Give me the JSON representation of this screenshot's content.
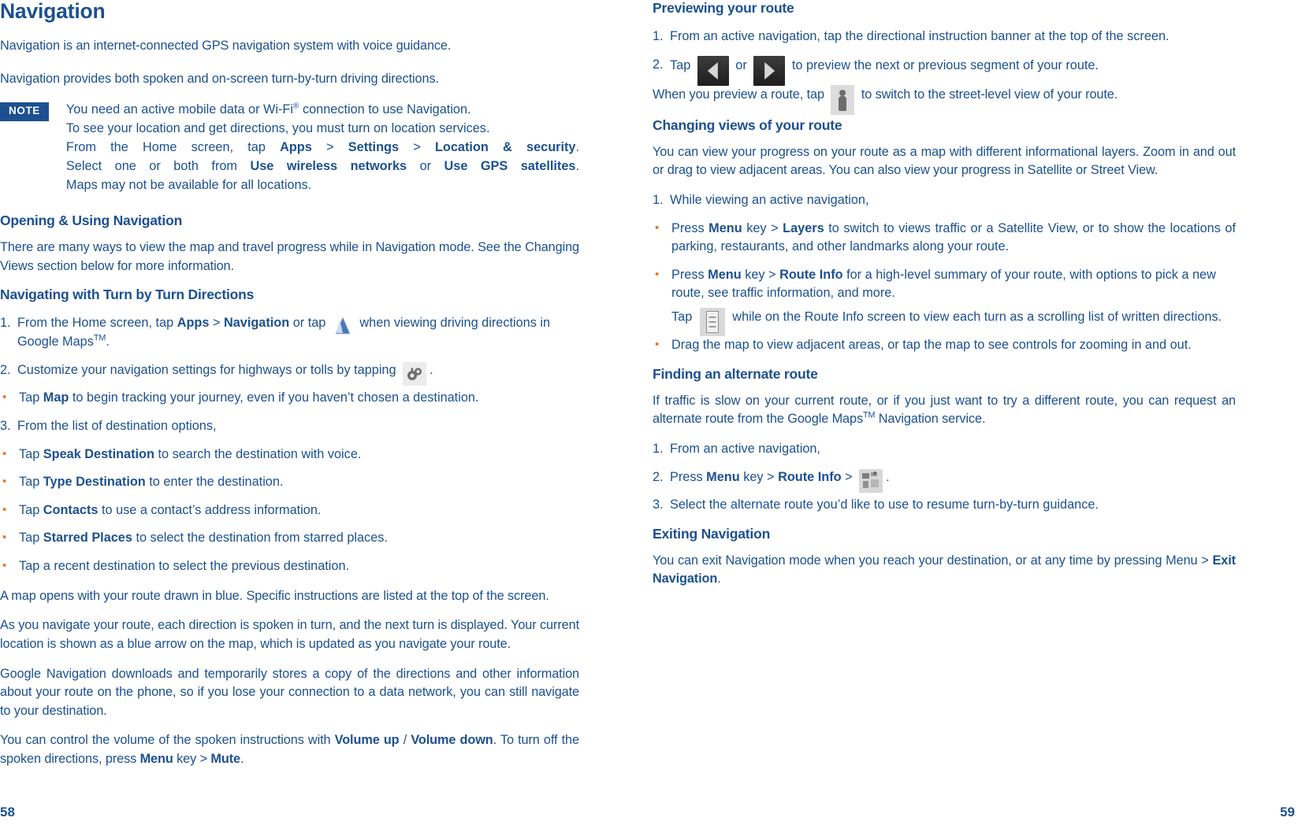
{
  "document": {
    "type": "user-manual-spread",
    "accent_color": "#1c5090",
    "bullet_color": "#e8762c",
    "note_badge_bg": "#1c5090"
  },
  "left_page": {
    "folio": "58",
    "title": "Navigation",
    "intro_1": "Navigation is an internet-connected GPS navigation system with voice guidance.",
    "intro_2": "Navigation provides both spoken and on-screen turn-by-turn driving directions.",
    "note": {
      "badge": "NOTE",
      "line_1_a": "You need an active mobile data or Wi-Fi",
      "line_1_sup": "®",
      "line_1_b": " connection to use Navigation.",
      "line_2": "To see your location and get directions, you must turn on location services.",
      "line_3_a": "From the Home screen, tap ",
      "line_3_b_apps": "Apps",
      "line_3_c": " > ",
      "line_3_d_settings": "Settings",
      "line_3_e": " > ",
      "line_3_f_location": "Location & security",
      "line_3_g": ".",
      "line_4_a": "Select one or both from ",
      "line_4_b_wireless": "Use wireless networks",
      "line_4_c": " or ",
      "line_4_d_gps": "Use GPS satellites",
      "line_4_e": ".",
      "line_5": "Maps may not be available for all locations."
    },
    "section_opening": {
      "heading": "Opening & Using Navigation",
      "paragraph": "There are many ways to view the map and travel progress while in Navigation mode. See the Changing Views section below for more information."
    },
    "section_turnbyturn": {
      "heading": "Navigating with Turn by Turn Directions",
      "step1": {
        "marker": "1.",
        "part_a": "From the Home screen, tap ",
        "bold_apps": "Apps",
        "part_b": " > ",
        "bold_navigation": "Navigation",
        "part_c": " or tap ",
        "icon": "navigation-arrow-icon",
        "part_d": " when viewing driving directions in Google Maps",
        "tm": "TM",
        "part_e": "."
      },
      "step2": {
        "marker": "2.",
        "part_a": "Customize your navigation settings for highways or tolls by tapping ",
        "icon": "settings-gear-icon",
        "part_b": "."
      },
      "bullet_map": {
        "part_a": "Tap ",
        "bold": "Map",
        "part_b": " to begin tracking your journey, even if you haven’t chosen a destination."
      },
      "step3": {
        "marker": "3.",
        "text": "From the list of destination options,"
      },
      "bullets": [
        {
          "part_a": "Tap ",
          "bold": "Speak Destination",
          "part_b": " to search the destination with voice."
        },
        {
          "part_a": "Tap ",
          "bold": "Type Destination",
          "part_b": " to enter the destination."
        },
        {
          "part_a": "Tap ",
          "bold": "Contacts",
          "part_b": " to use a contact’s address information."
        },
        {
          "part_a": "Tap ",
          "bold": "Starred Places",
          "part_b": " to select the destination from starred places."
        },
        {
          "part_a": "Tap a recent destination to select the previous destination.",
          "bold": "",
          "part_b": ""
        }
      ],
      "para_map_opens": "A map opens with your route drawn in blue. Specific instructions are listed at the top of the screen.",
      "para_navigate": "As you navigate your route, each direction is spoken in turn, and the next turn is displayed. Your current location is shown as a blue arrow on the map, which is updated as you navigate your route.",
      "para_downloads": "Google Navigation downloads and temporarily stores a copy of the directions and other information about your route on the phone, so if you lose your connection to a data network, you can still navigate to your destination.",
      "para_volume": {
        "part_a": "You can control the volume of the spoken instructions with ",
        "bold_1": "Volume up",
        "part_b": " / ",
        "bold_2": "Volume down",
        "part_c": ". To turn off the spoken directions, press ",
        "bold_3": "Menu",
        "part_d": " key > ",
        "bold_4": "Mute",
        "part_e": "."
      }
    }
  },
  "right_page": {
    "folio": "59",
    "section_preview": {
      "heading": "Previewing your route",
      "step1": {
        "marker": "1.",
        "text": "From an active navigation, tap the directional instruction banner at the top of the screen."
      },
      "step2": {
        "marker": "2.",
        "part_a": "Tap ",
        "icon_left": "arrow-left-button-icon",
        "part_b": " or ",
        "icon_right": "arrow-right-button-icon",
        "part_c": " to preview the next or previous segment of your route."
      },
      "para_streetview": {
        "part_a": "When you preview a route, tap ",
        "icon": "street-view-pegman-icon",
        "part_b": " to switch to the street-level view of your route."
      }
    },
    "section_changing_views": {
      "heading": "Changing views of your route",
      "paragraph": "You can view your progress on your route as a map with different informational layers. Zoom in and out or drag to view adjacent areas. You can also view your progress in Satellite or Street View.",
      "step1": {
        "marker": "1.",
        "text": "While viewing an active navigation,"
      },
      "bullet_layers": {
        "part_a": "Press ",
        "bold_1": "Menu",
        "part_b": " key > ",
        "bold_2": "Layers",
        "part_c": " to switch to views traffic or a Satellite View, or to show the locations of parking, restaurants, and other landmarks along your route."
      },
      "bullet_routeinfo": {
        "part_a": "Press ",
        "bold_1": "Menu",
        "part_b": " key > ",
        "bold_2": "Route Info",
        "part_c": " for a high-level summary of your route, with options to pick a new route, see traffic information, and more."
      },
      "sub_tap_list": {
        "part_a": "Tap ",
        "icon": "written-directions-list-icon",
        "part_b": " while on the Route Info screen to view each turn as a scrolling list of written directions."
      },
      "bullet_drag": "Drag the map to view adjacent areas, or tap the map to see controls for zooming in and out."
    },
    "section_alternate": {
      "heading": "Finding an alternate route",
      "paragraph_a": "If traffic is slow on your current route, or if you just want to try a different route, you can request an alternate route from the Google Maps",
      "paragraph_tm": "TM",
      "paragraph_b": " Navigation service.",
      "step1": {
        "marker": "1.",
        "text": "From an active navigation,"
      },
      "step2": {
        "marker": "2.",
        "part_a": "Press ",
        "bold_1": "Menu",
        "part_b": " key > ",
        "bold_2": "Route Info",
        "part_c": " > ",
        "icon": "alternate-route-icon",
        "part_d": "."
      },
      "step3": {
        "marker": "3.",
        "text": "Select the alternate route you’d like to use to resume turn-by-turn guidance."
      }
    },
    "section_exiting": {
      "heading": "Exiting Navigation",
      "paragraph": {
        "part_a": "You can exit Navigation mode when you reach your destination, or at any time by pressing Menu > ",
        "bold": "Exit Navigation",
        "part_b": "."
      }
    }
  }
}
